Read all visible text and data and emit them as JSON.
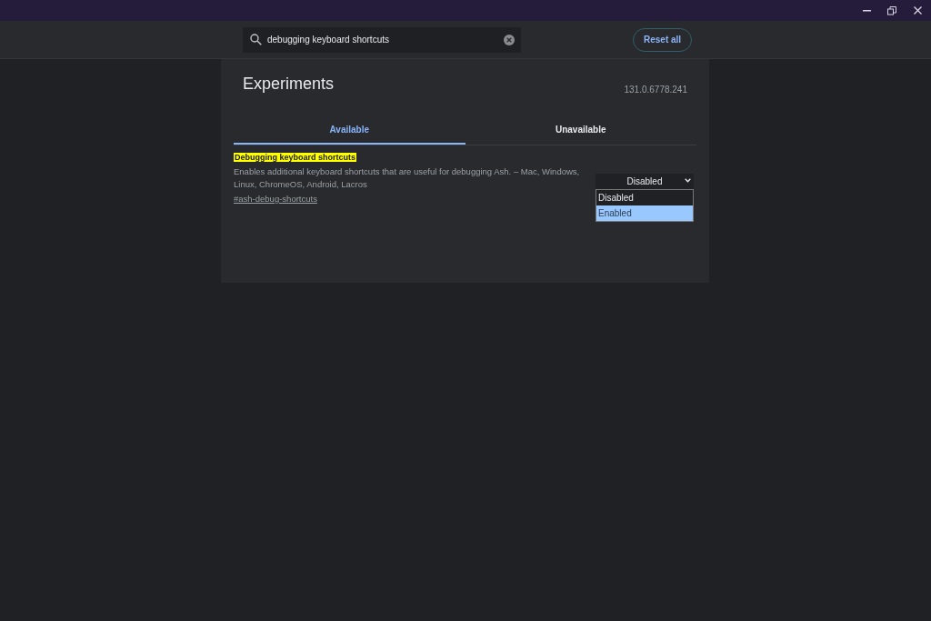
{
  "search": {
    "value": "debugging keyboard shortcuts"
  },
  "reset_button": "Reset all",
  "title": "Experiments",
  "version": "131.0.6778.241",
  "tabs": [
    {
      "label": "Available",
      "selected": true
    },
    {
      "label": "Unavailable",
      "selected": false
    }
  ],
  "experiments": [
    {
      "name": "Debugging keyboard shortcuts",
      "description": "Enables additional keyboard shortcuts that are useful for debugging Ash. – Mac, Windows, Linux, ChromeOS, Android, Lacros",
      "link": "#ash-debug-shortcuts",
      "value": "Disabled",
      "options": [
        {
          "label": "Disabled",
          "highlighted": false
        },
        {
          "label": "Enabled",
          "highlighted": true
        }
      ]
    }
  ]
}
